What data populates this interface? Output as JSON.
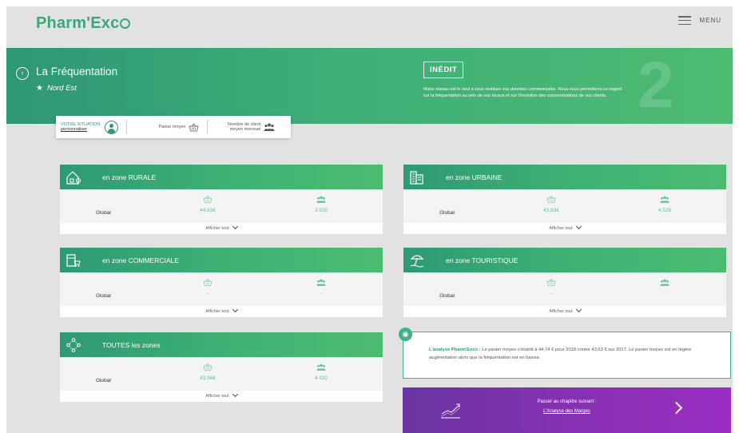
{
  "header": {
    "logo": "Pharm'Exc",
    "menu_label": "MENU"
  },
  "banner": {
    "title": "La Fréquentation",
    "region": "Nord Est",
    "badge": "INÉDIT",
    "text": "Notre réseau est le seul à vous restituer vos données commerciales. Nous vous permettons ce regard sur la fréquentation au sein de vos locaux et sur l'évolution des consommations de vos clients.",
    "chapter_number": "2"
  },
  "situation": {
    "label": "VOTRE SITUATION",
    "link": "personnaliser",
    "panier": "Panier moyen",
    "clients": "Nombre de client moyen mensuel"
  },
  "zones": [
    {
      "title": "en zone RURALE",
      "row_label": "Global",
      "panier": "44,63€",
      "clients": "3 920",
      "footer": "Afficher tout"
    },
    {
      "title": "en zone URBAINE",
      "row_label": "Global",
      "panier": "43,83€",
      "clients": "4 526",
      "footer": "Afficher tout"
    },
    {
      "title": "en zone COMMERCIALE",
      "row_label": "Global",
      "panier": "-",
      "clients": "-",
      "footer": "Afficher tout"
    },
    {
      "title": "en zone TOURISTIQUE",
      "row_label": "Global",
      "panier": "-",
      "clients": "-",
      "footer": "Afficher tout"
    },
    {
      "title": "TOUTES les zones",
      "row_label": "Global",
      "panier": "43,96€",
      "clients": "4 432",
      "footer": "Afficher tout"
    }
  ],
  "analysis": {
    "title": "L'analyse Pharm'Exco :",
    "text": " Le panier moyen s'établit à 44,74 € pour 2018 contre 43,63 € sur 2017. Le panier moyen est en légère augmentation alors que la fréquentation est en baisse."
  },
  "next": {
    "label": "Passer au chapitre suivant :",
    "link": "L'Analyse des Marges"
  },
  "colors": {
    "green": "#3aa876",
    "green_light": "#5fc08a",
    "purple": "#8a30b5"
  }
}
